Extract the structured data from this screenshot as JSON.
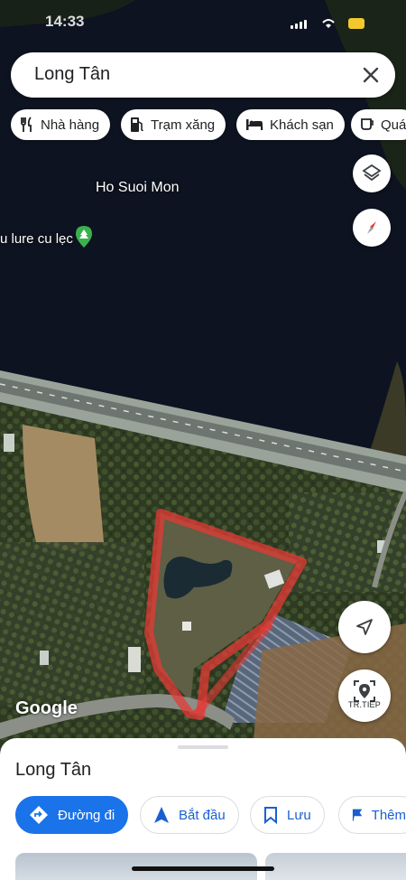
{
  "status_bar": {
    "time": "14:33"
  },
  "search": {
    "query": "Long Tân"
  },
  "filter_chips": [
    {
      "label": "Nhà hàng",
      "icon": "fork-knife-icon"
    },
    {
      "label": "Trạm xăng",
      "icon": "gas-station-icon"
    },
    {
      "label": "Khách sạn",
      "icon": "bed-icon"
    },
    {
      "label": "Quá",
      "icon": "coffee-cup-icon"
    }
  ],
  "map": {
    "labels": {
      "lake": "Ho Suoi Mon",
      "poi": "u lure cu lẹc"
    },
    "attribution": "Google",
    "live_button_label": "TR.TIẾP",
    "outline_color": "#e53935"
  },
  "sheet": {
    "title": "Long Tân",
    "actions": [
      {
        "label": "Đường đi",
        "icon": "directions-icon"
      },
      {
        "label": "Bắt đầu",
        "icon": "navigation-arrow-icon"
      },
      {
        "label": "Lưu",
        "icon": "bookmark-icon"
      },
      {
        "label": "Thêm",
        "icon": "flag-icon"
      }
    ]
  },
  "colors": {
    "accent": "#1a73e8",
    "lake": "#0d1320",
    "poi_pin": "#3bb04e"
  }
}
